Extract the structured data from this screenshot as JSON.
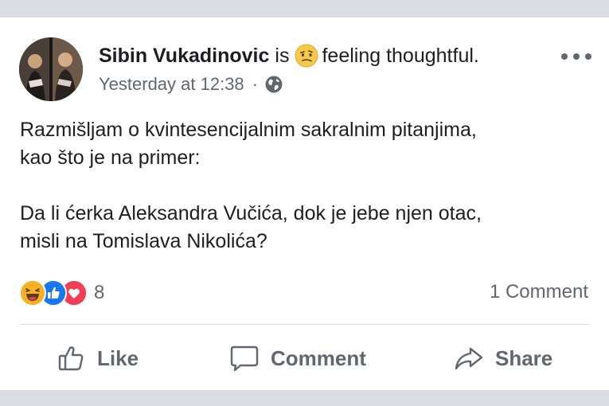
{
  "post": {
    "author": "Sibin Vukadinovic",
    "is_word": "is",
    "feeling_icon": "thinking-face-emoji",
    "feeling": "feeling thoughtful.",
    "timestamp": "Yesterday at 12:38",
    "separator": "·",
    "privacy_icon": "globe-icon",
    "text_lines": [
      "Razmišljam o kvintesencijalnim sakralnim pitanjima,",
      "kao što je na primer:",
      "Da li ćerka Aleksandra Vučića, dok je jebe njen otac,",
      "misli na Tomislava Nikolića?"
    ]
  },
  "reactions": {
    "icons": [
      "haha-icon",
      "like-icon",
      "love-icon"
    ],
    "count": "8",
    "comments": "1 Comment"
  },
  "actions": {
    "like": "Like",
    "comment": "Comment",
    "share": "Share"
  },
  "colors": {
    "text": "#1c1e21",
    "muted": "#606770",
    "like_blue": "#1877f2",
    "love_red": "#f33e58",
    "haha_yellow": "#f7b125",
    "band": "#dadde1"
  }
}
